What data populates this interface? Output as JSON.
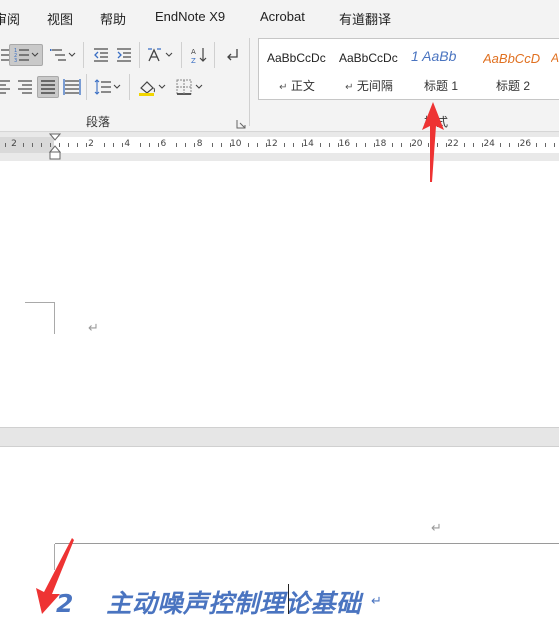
{
  "menu": [
    "审阅",
    "视图",
    "帮助",
    "EndNote X9",
    "Acrobat",
    "有道翻译"
  ],
  "ribbon": {
    "paragraph_group_label": "段落",
    "styles_group_label": "样式",
    "styles": [
      {
        "preview": "AaBbCcDc",
        "name": "正文",
        "color": "#222222",
        "mark": "↵"
      },
      {
        "preview": "AaBbCcDc",
        "name": "无间隔",
        "color": "#222222",
        "mark": "↵"
      },
      {
        "preview": "1 AaBb",
        "name": "标题 1",
        "color": "#4a74c0",
        "mark": ""
      },
      {
        "preview": "AaBbCcD",
        "name": "标题 2",
        "color": "#e07020",
        "mark": ""
      }
    ]
  },
  "ruler": {
    "labels": [
      "2",
      "2",
      "4",
      "6",
      "8",
      "10",
      "12",
      "14",
      "16",
      "18",
      "20",
      "22",
      "24",
      "26"
    ]
  },
  "document": {
    "paragraph_mark": "↵",
    "heading": {
      "number": "2",
      "text": "主动噪声控制理论基础"
    }
  },
  "colors": {
    "accent": "#4a74c0",
    "arrow": "#ee3333"
  }
}
